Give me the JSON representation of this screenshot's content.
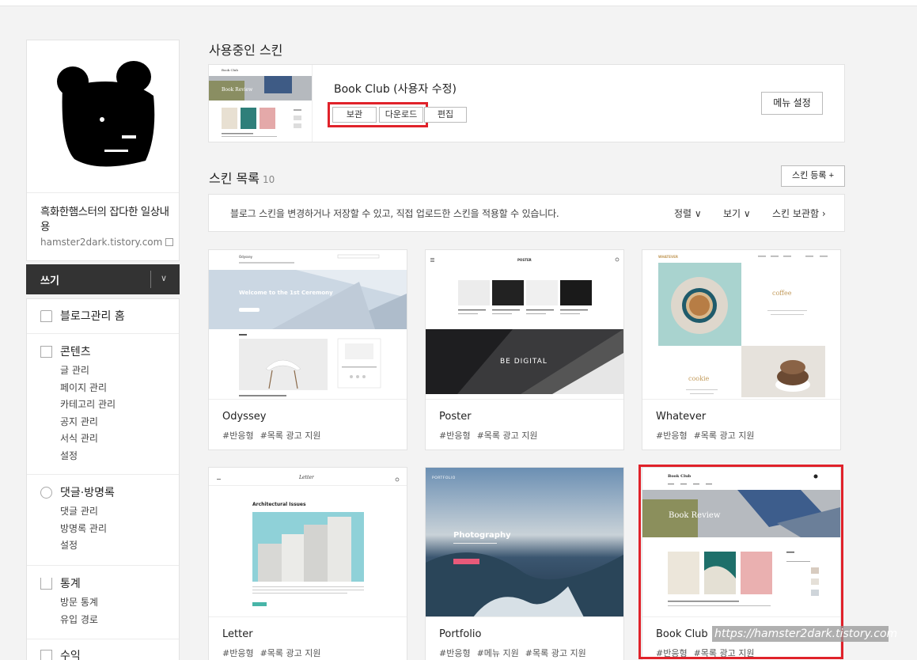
{
  "profile": {
    "blog_title": "흑화한햄스터의 잡다한 일상내용",
    "blog_url": "hamster2dark.tistory.com"
  },
  "write": {
    "label": "쓰기"
  },
  "sidebar": {
    "home": "블로그관리 홈",
    "sections": [
      {
        "title": "콘텐츠",
        "items": [
          "글 관리",
          "페이지 관리",
          "카테고리 관리",
          "공지 관리",
          "서식 관리",
          "설정"
        ]
      },
      {
        "title": "댓글·방명록",
        "items": [
          "댓글 관리",
          "방명록 관리",
          "설정"
        ]
      },
      {
        "title": "통계",
        "items": [
          "방문 통계",
          "유입 경로"
        ]
      },
      {
        "title": "수익",
        "items": []
      }
    ]
  },
  "current_skin": {
    "heading": "사용중인 스킨",
    "name": "Book Club (사용자 수정)",
    "btn_save": "보관",
    "btn_download": "다운로드",
    "btn_edit": "편집",
    "btn_menu": "메뉴 설정"
  },
  "skin_list": {
    "heading": "스킨 목록",
    "count": "10",
    "register": "스킨 등록 +",
    "description": "블로그 스킨을 변경하거나 저장할 수 있고, 직접 업로드한 스킨을 적용할 수 있습니다.",
    "sort": "정렬 ∨",
    "view": "보기 ∨",
    "storage": "스킨 보관함 ›"
  },
  "skins": [
    {
      "name": "Odyssey",
      "tags": [
        "#반응형",
        "#목록 광고 지원"
      ]
    },
    {
      "name": "Poster",
      "tags": [
        "#반응형",
        "#목록 광고 지원"
      ]
    },
    {
      "name": "Whatever",
      "tags": [
        "#반응형",
        "#목록 광고 지원"
      ]
    },
    {
      "name": "Letter",
      "tags": [
        "#반응형",
        "#목록 광고 지원"
      ]
    },
    {
      "name": "Portfolio",
      "tags": [
        "#반응형",
        "#메뉴 지원",
        "#목록 광고 지원"
      ]
    },
    {
      "name": "Book Club",
      "tags": [
        "#반응형",
        "#목록 광고 지원"
      ]
    }
  ],
  "previews": {
    "book_club_brand": "Book Club",
    "book_review": "Book Review",
    "odyssey_brand": "Odyssey",
    "odyssey_hero": "Welcome to the 1st Ceremony",
    "poster_brand": "POSTER",
    "poster_hero": "BE DIGITAL",
    "whatever_brand": "WHATEVER",
    "whatever_coffee": "coffee",
    "whatever_cookie": "cookie",
    "letter_brand": "Letter",
    "letter_post": "Architectural Issues",
    "portfolio_brand": "PORTFOLIO",
    "portfolio_hero": "Photography"
  },
  "watermark": "https://hamster2dark.tistory.com",
  "colors": {
    "highlight": "#e0222a",
    "write_bg": "#333333"
  }
}
